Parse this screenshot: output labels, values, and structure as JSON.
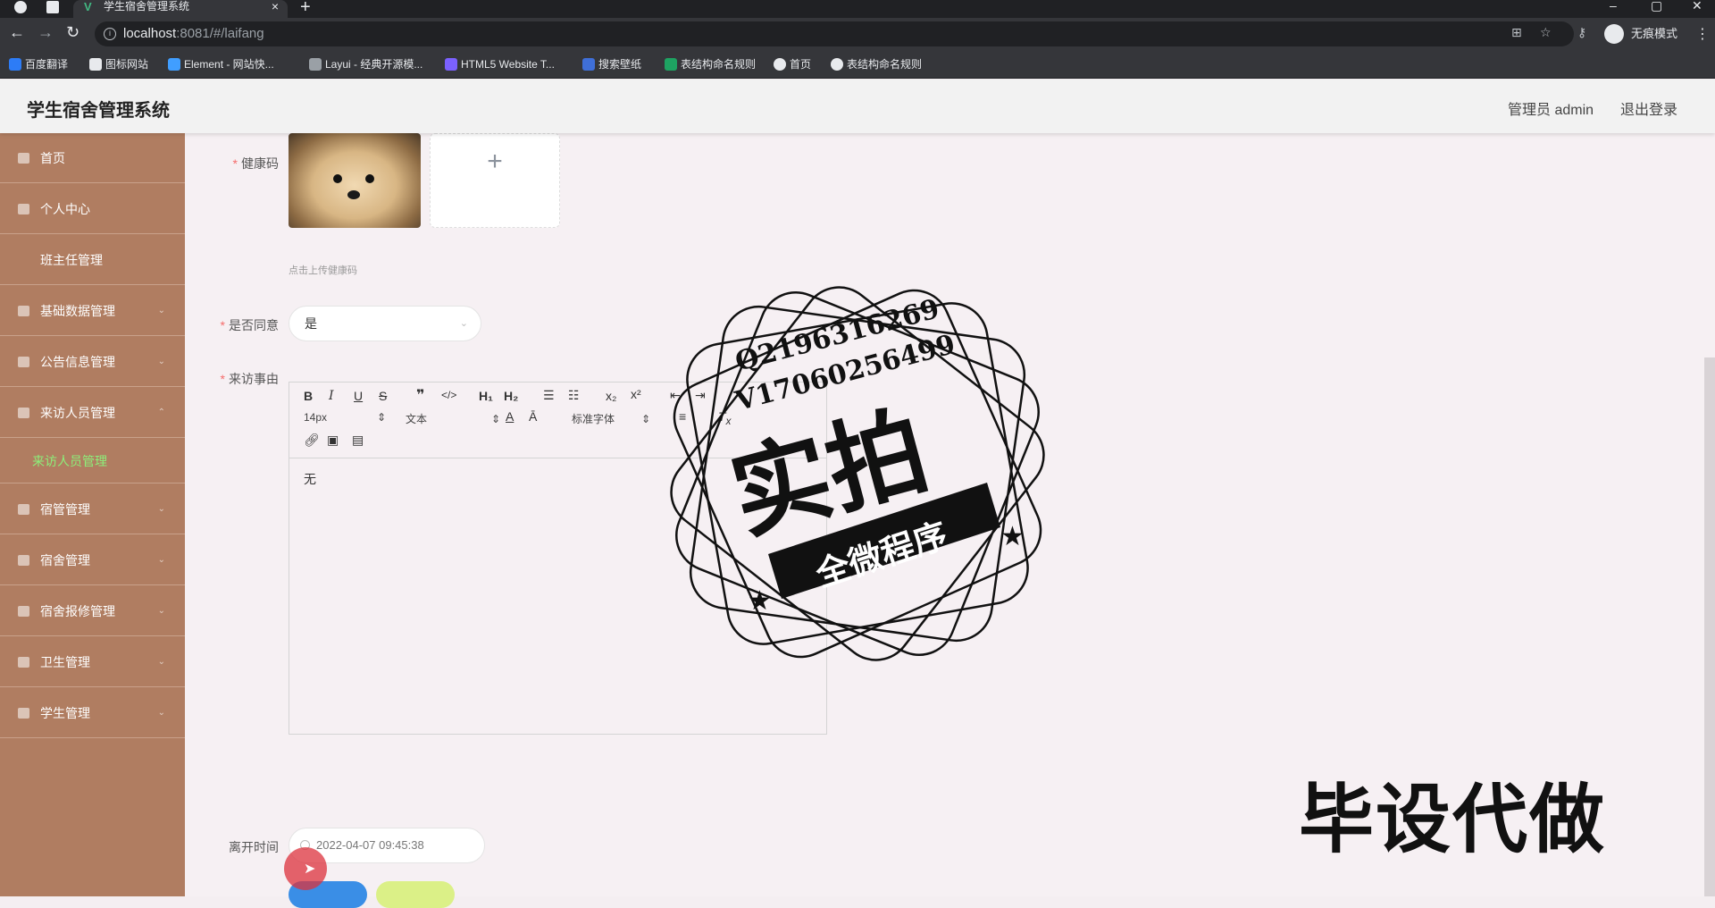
{
  "browser": {
    "tab_title": "学生宿舍管理系统",
    "url_host": "localhost",
    "url_path": ":8081/#/laifang",
    "profile_label": "无痕模式",
    "bookmarks": [
      "百度翻译",
      "图标网站",
      "Element - 网站快...",
      "Layui - 经典开源模...",
      "HTML5 Website T...",
      "搜索壁纸",
      "表结构命名规则",
      "首页",
      "表结构命名规则"
    ]
  },
  "header": {
    "title": "学生宿舍管理系统",
    "admin_label": "管理员 admin",
    "logout_label": "退出登录"
  },
  "sidebar": {
    "items": [
      {
        "label": "首页"
      },
      {
        "label": "个人中心"
      },
      {
        "label": "班主任管理"
      },
      {
        "label": "基础数据管理"
      },
      {
        "label": "公告信息管理"
      },
      {
        "label": "来访人员管理"
      },
      {
        "label": "来访人员管理"
      },
      {
        "label": "宿管管理"
      },
      {
        "label": "宿舍管理"
      },
      {
        "label": "宿舍报修管理"
      },
      {
        "label": "卫生管理"
      },
      {
        "label": "学生管理"
      }
    ]
  },
  "form": {
    "health_code_label": "健康码",
    "upload_hint": "点击上传健康码",
    "agree_label": "是否同意",
    "agree_value": "是",
    "reason_label": "来访事由",
    "editor_font_size": "14px",
    "editor_text_type": "文本",
    "editor_font_family": "标准字体",
    "editor_content": "无",
    "leave_time_label": "离开时间",
    "leave_time_value": "2022-04-07 09:45:38"
  },
  "watermark": {
    "qq": "Q2196316269",
    "vx": "V17060256499",
    "big": "实拍",
    "ribbon": "全微程序",
    "corner": "毕设代做"
  },
  "colors": {
    "sidebar_bg": "#b07d61",
    "sidebar_active": "#8cf07a",
    "required_star": "#f56c6c",
    "submit_button": "#3a8ee6",
    "cancel_button": "#dbf087"
  }
}
